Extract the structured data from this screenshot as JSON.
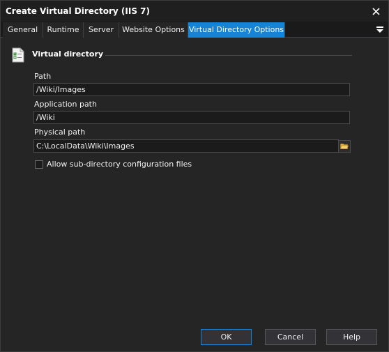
{
  "window": {
    "title": "Create Virtual Directory (IIS 7)"
  },
  "tabs": [
    {
      "label": "General"
    },
    {
      "label": "Runtime"
    },
    {
      "label": "Server"
    },
    {
      "label": "Website Options"
    },
    {
      "label": "Virtual Directory Options",
      "active": true
    }
  ],
  "section": {
    "title": "Virtual directory",
    "icon": "checklist-document-icon"
  },
  "fields": {
    "path": {
      "label": "Path",
      "value": "/Wiki/Images"
    },
    "application_path": {
      "label": "Application path",
      "value": "/Wiki"
    },
    "physical_path": {
      "label": "Physical path",
      "value": "C:\\LocalData\\Wiki\\Images",
      "browse_icon": "folder-open-icon"
    }
  },
  "checkbox": {
    "label": "Allow sub-directory configuration files",
    "checked": false
  },
  "buttons": {
    "ok": "OK",
    "cancel": "Cancel",
    "help": "Help"
  },
  "colors": {
    "accent": "#1684d6",
    "background": "#252526",
    "field_bg": "#1b1b1b",
    "text": "#f0f0f0"
  }
}
